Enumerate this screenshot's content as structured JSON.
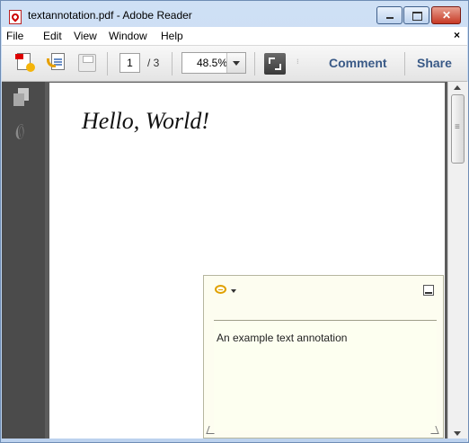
{
  "window": {
    "title": "textannotation.pdf - Adobe Reader"
  },
  "menu": {
    "items": [
      "File",
      "Edit",
      "View",
      "Window",
      "Help"
    ],
    "close_label": "×"
  },
  "toolbar": {
    "current_page": "1",
    "total_pages": "/ 3",
    "zoom": "48.5%",
    "comment_label": "Comment",
    "share_label": "Share",
    "grip": "⁝"
  },
  "document": {
    "text": "Hello, World!"
  },
  "annotation": {
    "text": "An example text annotation"
  },
  "colors": {
    "accent": "#3a5a87",
    "sidebar": "#4b4b4b",
    "note_background": "#fdfdf0",
    "note_icon": "#e0a000"
  }
}
